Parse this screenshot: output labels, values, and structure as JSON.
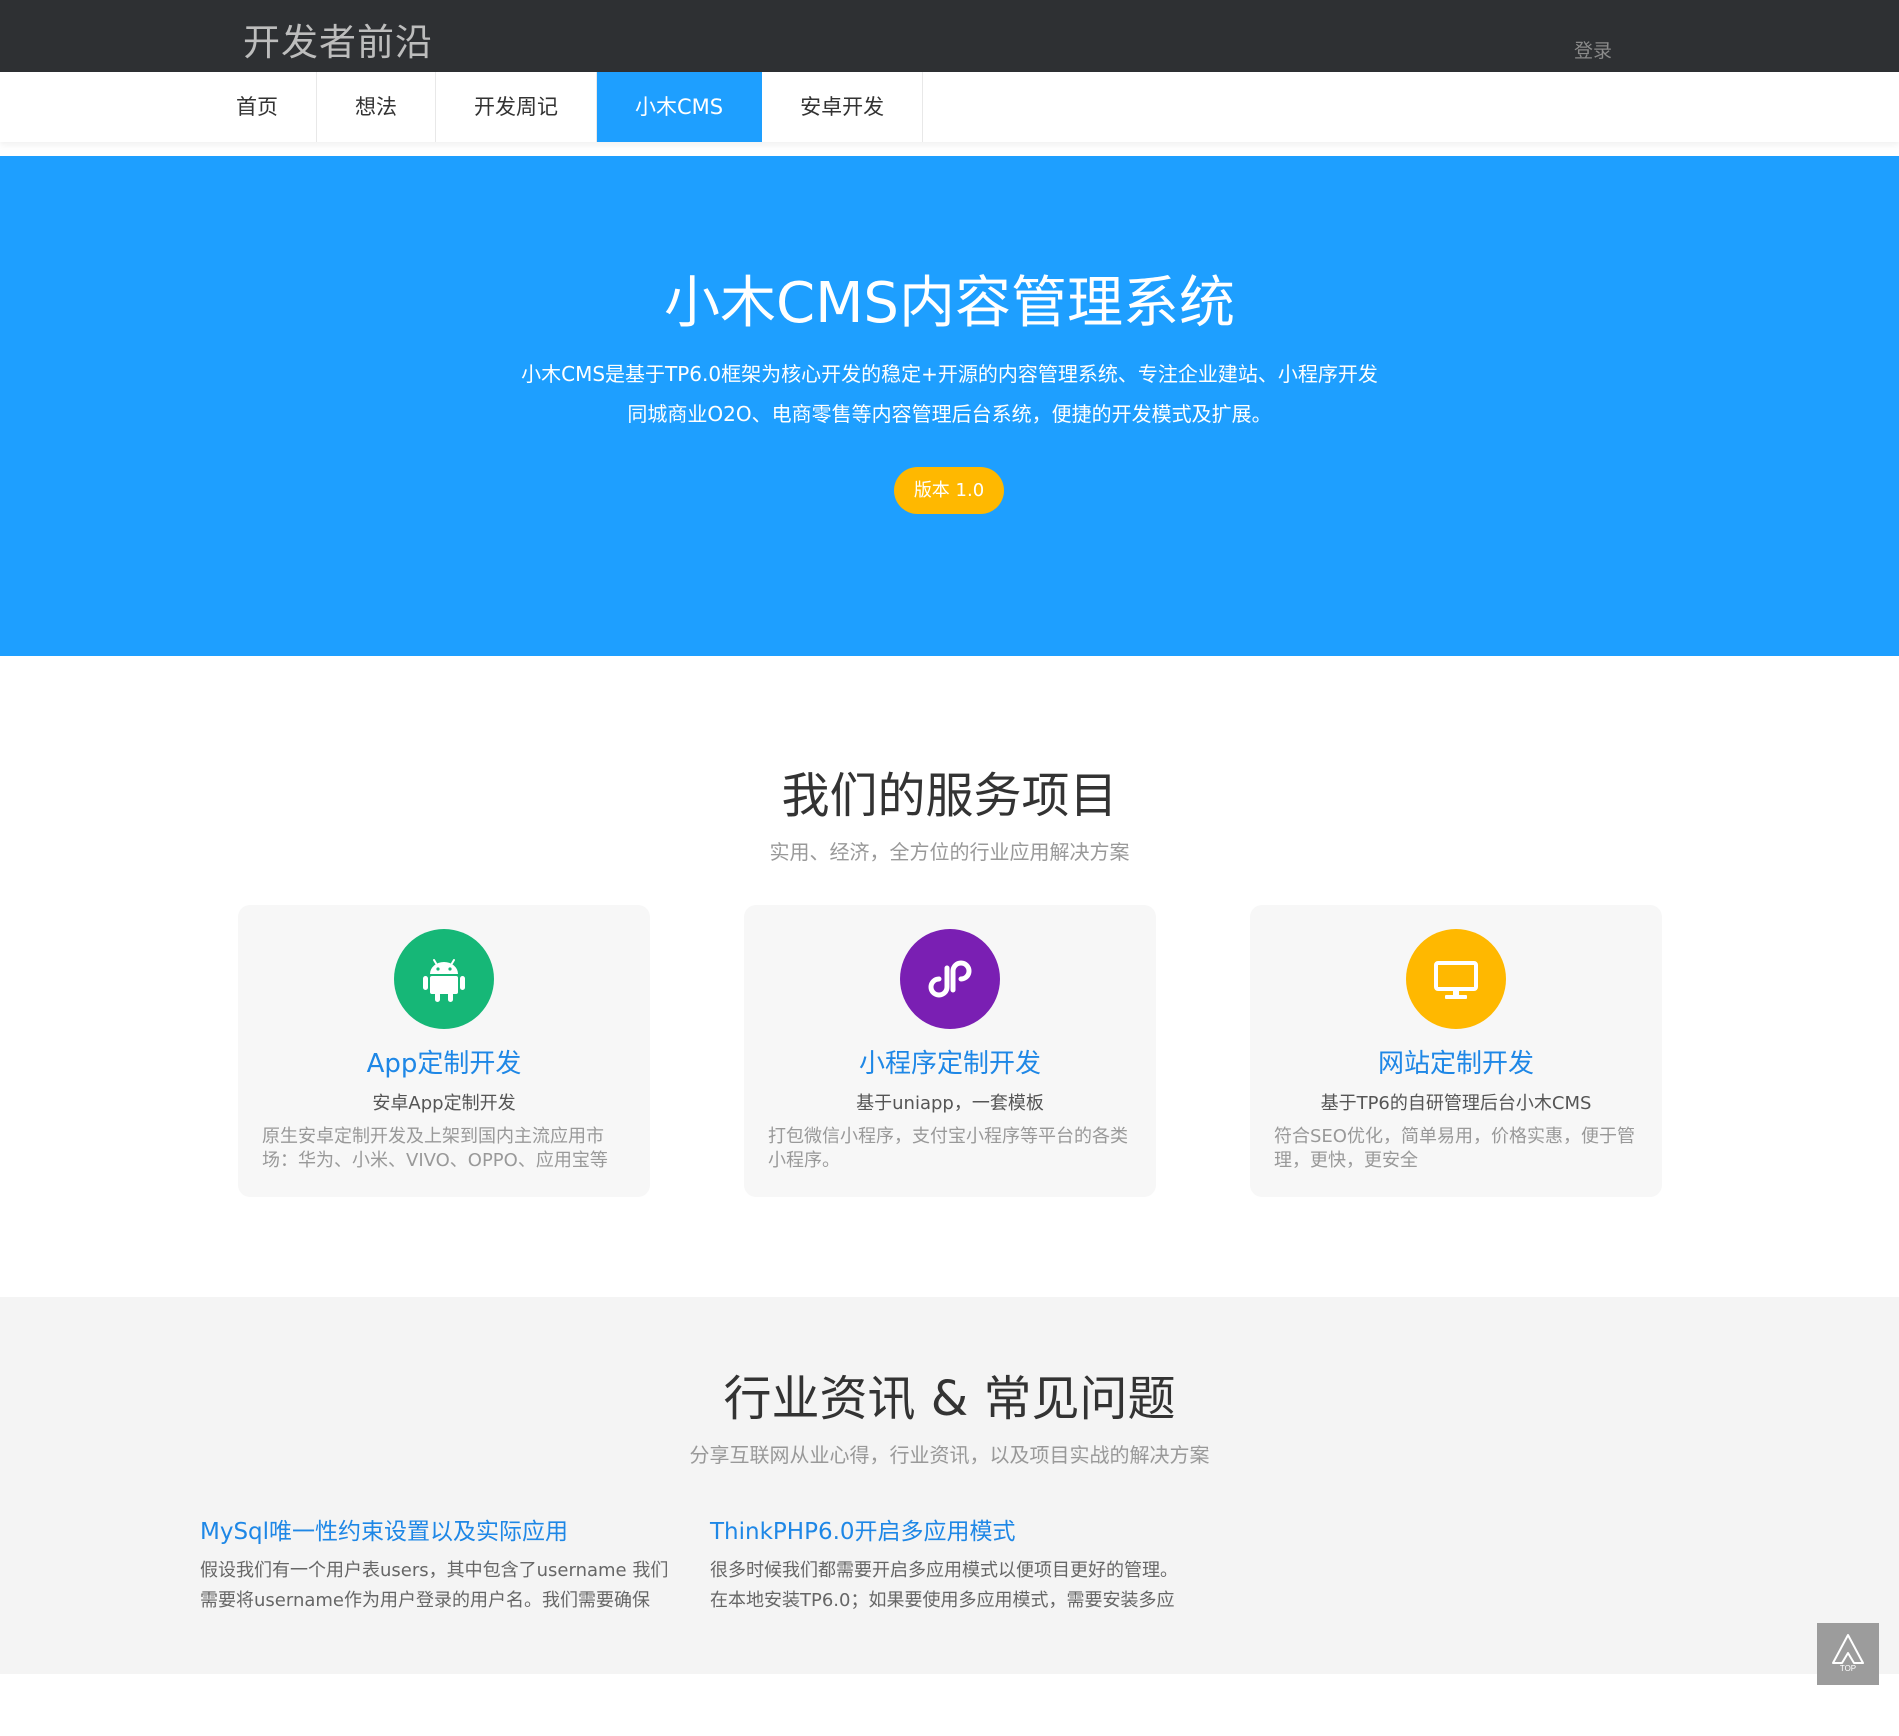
{
  "header": {
    "brand": "开发者前沿",
    "login": "登录"
  },
  "nav": {
    "items": [
      {
        "label": "首页"
      },
      {
        "label": "想法"
      },
      {
        "label": "开发周记"
      },
      {
        "label": "小木CMS",
        "active": true
      },
      {
        "label": "安卓开发"
      }
    ]
  },
  "hero": {
    "title": "小木CMS内容管理系统",
    "desc_line1": "小木CMS是基于TP6.0框架为核心开发的稳定+开源的内容管理系统、专注企业建站、小程序开发",
    "desc_line2": "同城商业O2O、电商零售等内容管理后台系统，便捷的开发模式及扩展。",
    "version_label": "版本 1.0"
  },
  "services": {
    "title": "我们的服务项目",
    "subtitle": "实用、经济，全方位的行业应用解决方案",
    "cards": [
      {
        "name": "App定制开发",
        "tag": "安卓App定制开发",
        "desc": "原生安卓定制开发及上架到国内主流应用市场：华为、小米、VIVO、OPPO、应用宝等",
        "icon": "android-icon",
        "color": "#16b777"
      },
      {
        "name": "小程序定制开发",
        "tag": "基于uniapp，一套模板",
        "desc": "打包微信小程序，支付宝小程序等平台的各类小程序。",
        "icon": "mini-program-icon",
        "color": "#7a1fb3"
      },
      {
        "name": "网站定制开发",
        "tag": "基于TP6的自研管理后台小木CMS",
        "desc": "符合SEO优化，简单易用，价格实惠，便于管理，更快，更安全",
        "icon": "monitor-icon",
        "color": "#ffb800"
      }
    ]
  },
  "news": {
    "title": "行业资讯 & 常见问题",
    "subtitle": "分享互联网从业心得，行业资讯，以及项目实战的解决方案",
    "items": [
      {
        "title": "MySql唯一性约束设置以及实际应用",
        "summary": "假设我们有一个用户表users，其中包含了username 我们需要将username作为用户登录的用户名。我们需要确保usernam..."
      },
      {
        "title": "ThinkPHP6.0开启多应用模式",
        "summary": "很多时候我们都需要开启多应用模式以便项目更好的管理。在本地安装TP6.0；如果要使用多应用模式，需要安装多应用..."
      }
    ]
  },
  "back_to_top": {
    "label": "TOP",
    "icon": "back-to-top-icon"
  }
}
